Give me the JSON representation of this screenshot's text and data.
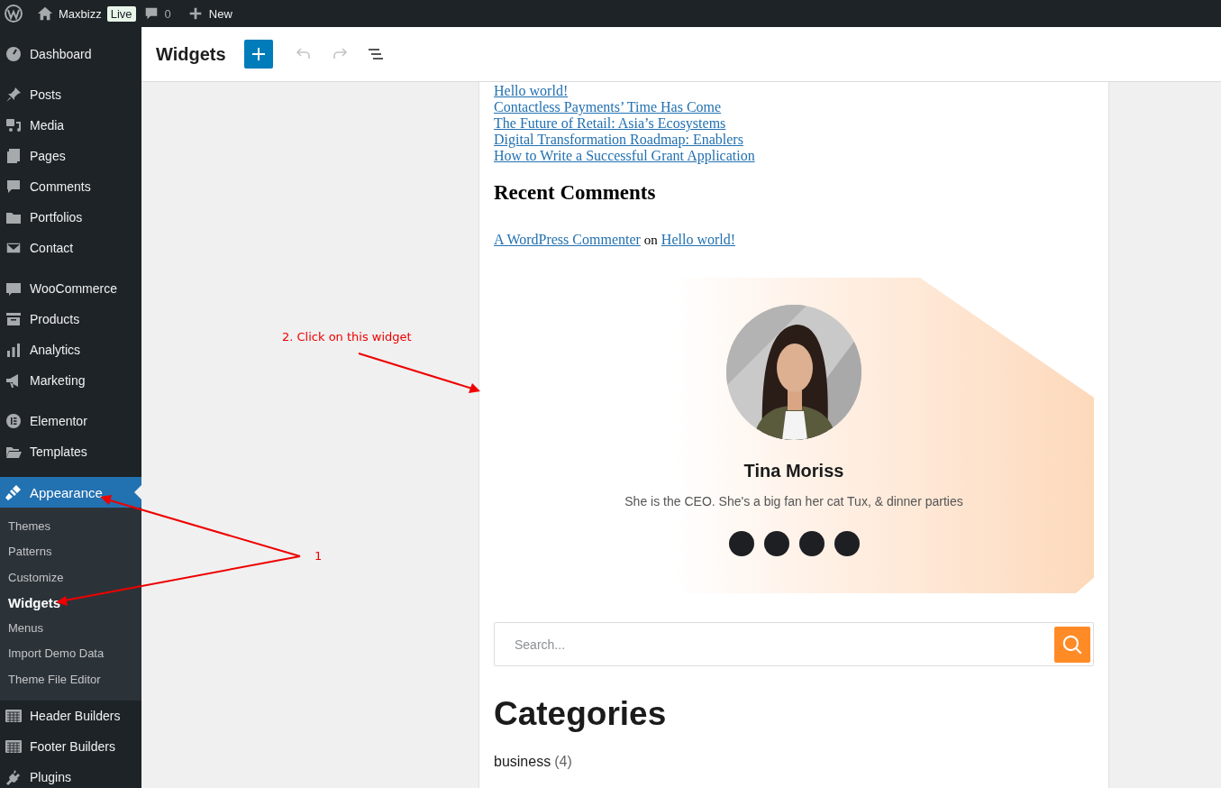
{
  "admin_bar": {
    "site_name": "Maxbizz",
    "status_badge": "Live",
    "comment_count": "0",
    "new_label": "New"
  },
  "sidebar": {
    "groups": [
      [
        {
          "label": "Dashboard",
          "selected": false
        }
      ],
      [
        {
          "label": "Posts",
          "selected": false
        },
        {
          "label": "Media",
          "selected": false
        },
        {
          "label": "Pages",
          "selected": false
        },
        {
          "label": "Comments",
          "selected": false
        },
        {
          "label": "Portfolios",
          "selected": false
        },
        {
          "label": "Contact",
          "selected": false
        }
      ],
      [
        {
          "label": "WooCommerce",
          "selected": false
        },
        {
          "label": "Products",
          "selected": false
        },
        {
          "label": "Analytics",
          "selected": false
        },
        {
          "label": "Marketing",
          "selected": false
        }
      ],
      [
        {
          "label": "Elementor",
          "selected": false
        },
        {
          "label": "Templates",
          "selected": false
        }
      ],
      [
        {
          "label": "Appearance",
          "selected": true,
          "submenu": [
            {
              "label": "Themes",
              "selected": false
            },
            {
              "label": "Patterns",
              "selected": false
            },
            {
              "label": "Customize",
              "selected": false
            },
            {
              "label": "Widgets",
              "selected": true
            },
            {
              "label": "Menus",
              "selected": false
            },
            {
              "label": "Import Demo Data",
              "selected": false
            },
            {
              "label": "Theme File Editor",
              "selected": false
            }
          ]
        },
        {
          "label": "Header Builders",
          "selected": false
        },
        {
          "label": "Footer Builders",
          "selected": false
        },
        {
          "label": "Plugins",
          "selected": false
        }
      ]
    ]
  },
  "header": {
    "title": "Widgets",
    "undo_disabled": true,
    "redo_disabled": true
  },
  "content": {
    "recent_posts": [
      "Hello world!",
      "Contactless Payments’ Time Has Come",
      "The Future of Retail: Asia’s Ecosystems",
      "Digital Transformation Roadmap: Enablers",
      "How to Write a Successful Grant Application"
    ],
    "comments_heading": "Recent Comments",
    "comment": {
      "author": "A WordPress Commenter",
      "joiner": "on",
      "post": "Hello world!"
    },
    "team_card": {
      "name": "Tina Moriss",
      "bio": "She is the CEO. She's a big fan her cat Tux, & dinner parties",
      "social_links": [
        {
          "kind": "circle"
        },
        {
          "kind": "circle"
        },
        {
          "kind": "circle"
        },
        {
          "kind": "circle"
        }
      ]
    },
    "search": {
      "placeholder": "Search..."
    },
    "categories_heading": "Categories",
    "categories": [
      {
        "name": "business",
        "count": "(4)"
      }
    ]
  },
  "annotations": [
    {
      "text": "2. Click on this widget"
    },
    {
      "text": "1"
    }
  ]
}
